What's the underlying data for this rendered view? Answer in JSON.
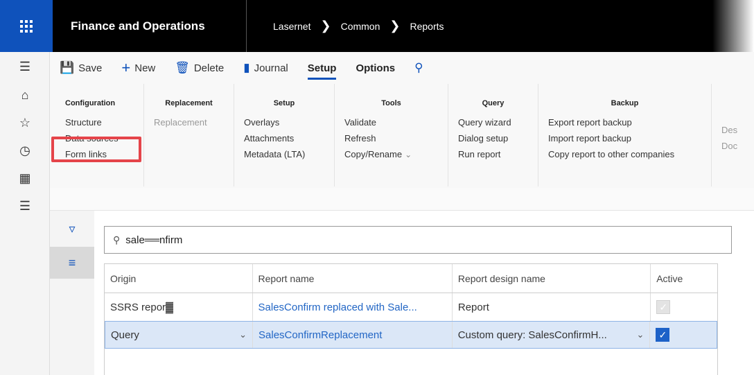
{
  "topbar": {
    "app_title": "Finance and Operations",
    "breadcrumb": [
      "Lasernet",
      "Common",
      "Reports"
    ],
    "sep": "❯"
  },
  "actions": {
    "save": "Save",
    "new": "New",
    "delete": "Delete",
    "journal": "Journal",
    "tab_setup": "Setup",
    "tab_options": "Options"
  },
  "ribbon": {
    "configuration": {
      "title": "Configuration",
      "items": [
        "Structure",
        "Data sources",
        "Form links"
      ]
    },
    "replacement": {
      "title": "Replacement",
      "items": [
        "Replacement"
      ]
    },
    "setup": {
      "title": "Setup",
      "items": [
        "Overlays",
        "Attachments",
        "Metadata (LTA)"
      ]
    },
    "tools": {
      "title": "Tools",
      "items": [
        "Validate",
        "Refresh",
        "Copy/Rename"
      ]
    },
    "query": {
      "title": "Query",
      "items": [
        "Query wizard",
        "Dialog setup",
        "Run report"
      ]
    },
    "backup": {
      "title": "Backup",
      "items": [
        "Export report backup",
        "Import report backup",
        "Copy report to other companies"
      ]
    },
    "cut": {
      "items": [
        "Des",
        "Doc"
      ]
    }
  },
  "search": {
    "value": "sale══nfirm"
  },
  "grid": {
    "headers": [
      "Origin",
      "Report name",
      "Report design name",
      "Active"
    ],
    "rows": [
      {
        "origin": "SSRS repor▓",
        "report_name": "SalesConfirm replaced with Sale...",
        "design": "Report",
        "active": true,
        "selected": false
      },
      {
        "origin": "Query",
        "report_name": "SalesConfirmReplacement",
        "design": "Custom query: SalesConfirmH...",
        "active": true,
        "selected": true
      }
    ]
  },
  "colors": {
    "accent": "#0f52bb",
    "highlight": "#e5444a",
    "link": "#2266c5"
  }
}
